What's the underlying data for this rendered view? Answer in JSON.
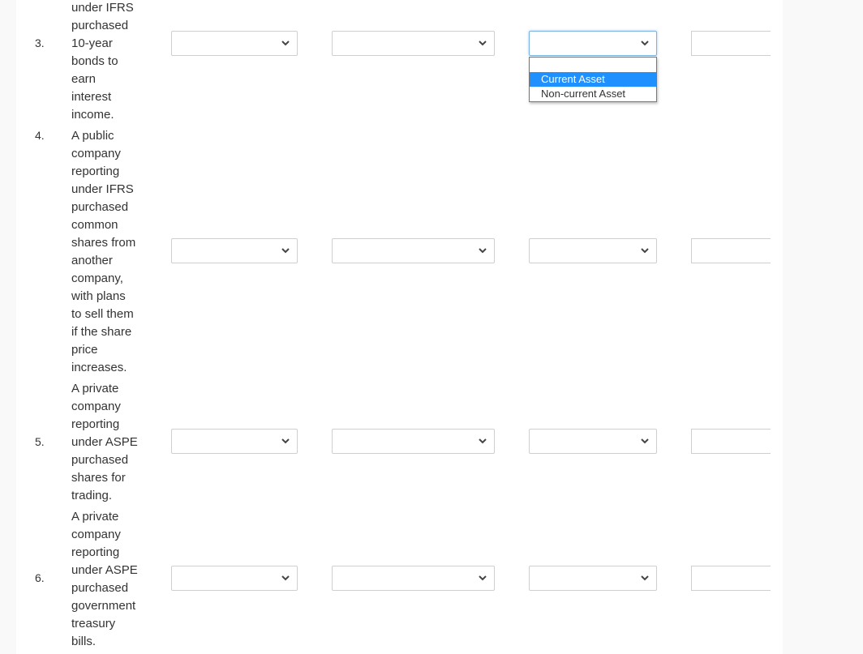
{
  "questions": [
    {
      "number": "3.",
      "lines": [
        "under IFRS",
        "purchased",
        "10-year",
        "bonds to",
        "earn",
        "interest",
        "income."
      ],
      "select1": "",
      "select2": "",
      "select3": "",
      "text_value": ""
    },
    {
      "number": "4.",
      "lines": [
        "A public",
        "company",
        "reporting",
        "under IFRS",
        "purchased",
        "common",
        "shares from",
        "another",
        "company,",
        "with plans",
        "to sell them",
        "if the share",
        "price",
        "increases."
      ],
      "select1": "",
      "select2": "",
      "select3": "",
      "text_value": ""
    },
    {
      "number": "5.",
      "lines": [
        "A private",
        "company",
        "reporting",
        "under ASPE",
        "purchased",
        "shares for",
        "trading."
      ],
      "select1": "",
      "select2": "",
      "select3": "",
      "text_value": ""
    },
    {
      "number": "6.",
      "lines": [
        "A private",
        "company",
        "reporting",
        "under ASPE",
        "purchased",
        "government",
        "treasury",
        "bills."
      ],
      "select1": "",
      "select2": "",
      "select3": "",
      "text_value": ""
    }
  ],
  "open_dropdown": {
    "options": [
      "",
      "Current Asset",
      "Non-current Asset"
    ],
    "highlighted": "Current Asset"
  },
  "colors": {
    "highlight": "#1e90ff",
    "focus_border": "#7ab3e3"
  }
}
